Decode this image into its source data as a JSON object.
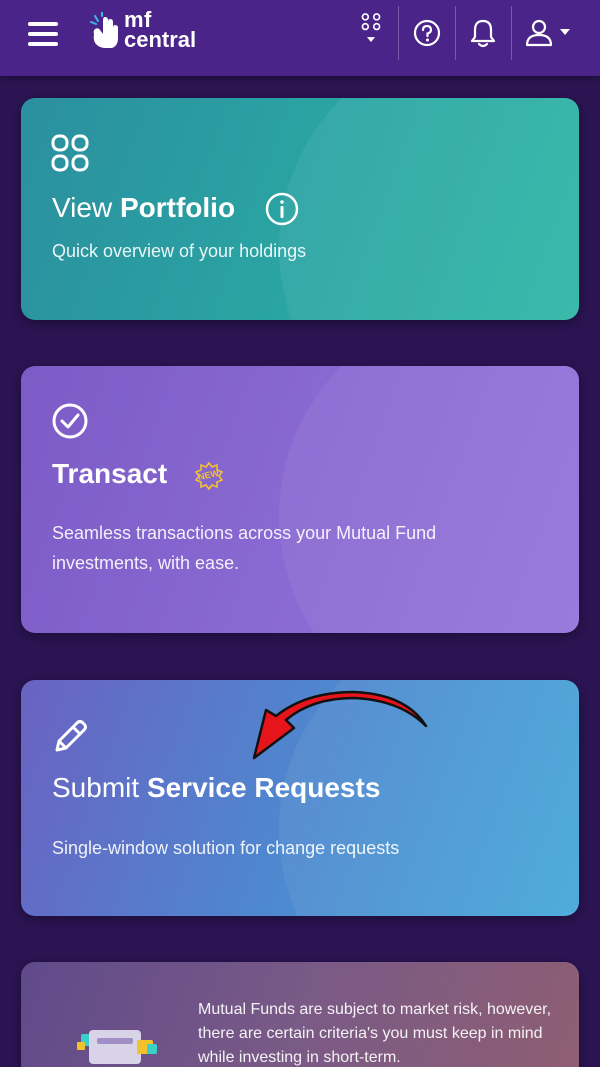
{
  "header": {
    "logo_line1": "mf",
    "logo_line2": "central"
  },
  "cards": [
    {
      "title_plain": "View ",
      "title_bold": "Portfolio",
      "description": "Quick overview of your holdings"
    },
    {
      "title_plain": "",
      "title_bold": "Transact",
      "badge": "NEW",
      "description": "Seamless transactions across your Mutual Fund investments, with ease."
    },
    {
      "title_plain": "Submit ",
      "title_bold": "Service Requests",
      "description": "Single-window solution for change requests"
    }
  ],
  "promo": {
    "text": "Mutual Funds are subject to market risk, however, there are certain criteria's you must keep in mind while investing in short-term."
  },
  "colors": {
    "background": "#2a1452",
    "header": "#4b2489",
    "portfolio_card": "#2aa6a3",
    "transact_card": "#8a6ad3",
    "service_card": "#4e88cf",
    "arrow": "#e8141b",
    "badge": "#f2c12e"
  },
  "icons": [
    "menu-icon",
    "logo-hand-icon",
    "apps-grid-icon",
    "help-icon",
    "bell-icon",
    "user-icon",
    "chevron-down-icon",
    "grid-four-icon",
    "info-icon",
    "check-circle-icon",
    "pencil-icon",
    "new-badge-icon",
    "arrow-annotation"
  ]
}
